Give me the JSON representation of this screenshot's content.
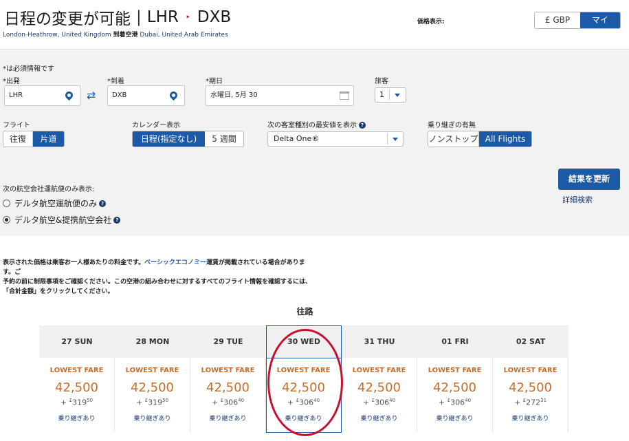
{
  "header": {
    "title_prefix": "日程の変更が可能",
    "origin_code": "LHR",
    "dest_code": "DXB",
    "separator": "|",
    "arrow": "‣",
    "origin_name": "London-Heathrow, United Kingdom",
    "to_label": "到着空港",
    "dest_name": "Dubai, United Arab Emirates",
    "price_display_label": "価格表示:",
    "currency_options": [
      "£ GBP",
      "マイル"
    ],
    "currency_selected": "マイル"
  },
  "form": {
    "required_note": "*は必須情報です",
    "origin_label": "出発",
    "origin_value": "LHR",
    "dest_label": "到着",
    "dest_value": "DXB",
    "date_label": "期日",
    "date_value": "水曜日, 5月 30",
    "passengers_label": "旅客",
    "passengers_value": "1",
    "flight_label": "フライト",
    "flight_options": [
      "往復",
      "片道"
    ],
    "flight_selected": "片道",
    "calendar_label": "カレンダー表示",
    "calendar_options": [
      "日程(指定なし)",
      "5 週間"
    ],
    "calendar_selected": "日程(指定なし)",
    "cabin_label": "次の客室種別の最安値を表示",
    "cabin_value": "Delta One®",
    "connection_label": "乗り継ぎの有無",
    "connection_options": [
      "ノンストップ",
      "All Flights"
    ],
    "connection_selected": "All Flights",
    "update_button": "結果を更新",
    "advanced_search": "詳細検索",
    "carrier_filter_label": "次の航空会社運航便のみ表示:",
    "carrier_options": [
      "デルタ航空運航便のみ",
      "デルタ航空&提携航空会社"
    ],
    "carrier_selected": "デルタ航空&提携航空会社",
    "help_glyph": "?"
  },
  "notice": {
    "line1_a": "表示された価格は乗客お一人様あたりの料金です。",
    "line1_link": "ベーシックエコノミー",
    "line1_b": "運賃が掲載されている場合があります。ご",
    "line2": "予約の前に制限事項をご確認ください。この空港の組み合わせに対するすべてのフライト情報を確認するには、",
    "line3": "「合計金額」をクリックしてください。"
  },
  "fare_calendar": {
    "direction_title": "往路",
    "selected_index": 3,
    "days": [
      {
        "label": "27 SUN",
        "fare_label": "LOWEST FARE",
        "miles": "42,500",
        "gbp_prefix": "+ ",
        "gbp_currency": "£",
        "gbp_main": "319",
        "gbp_cents": "50",
        "stops": "乗り継ぎあり"
      },
      {
        "label": "28 MON",
        "fare_label": "LOWEST FARE",
        "miles": "42,500",
        "gbp_prefix": "+ ",
        "gbp_currency": "£",
        "gbp_main": "319",
        "gbp_cents": "50",
        "stops": "乗り継ぎあり"
      },
      {
        "label": "29 TUE",
        "fare_label": "LOWEST FARE",
        "miles": "42,500",
        "gbp_prefix": "+ ",
        "gbp_currency": "£",
        "gbp_main": "306",
        "gbp_cents": "40",
        "stops": "乗り継ぎあり"
      },
      {
        "label": "30 WED",
        "fare_label": "LOWEST FARE",
        "miles": "42,500",
        "gbp_prefix": "+ ",
        "gbp_currency": "£",
        "gbp_main": "306",
        "gbp_cents": "40",
        "stops": "乗り継ぎあり"
      },
      {
        "label": "31 THU",
        "fare_label": "LOWEST FARE",
        "miles": "42,500",
        "gbp_prefix": "+ ",
        "gbp_currency": "£",
        "gbp_main": "306",
        "gbp_cents": "40",
        "stops": "乗り継ぎあり"
      },
      {
        "label": "01 FRI",
        "fare_label": "LOWEST FARE",
        "miles": "42,500",
        "gbp_prefix": "+ ",
        "gbp_currency": "£",
        "gbp_main": "306",
        "gbp_cents": "40",
        "stops": "乗り継ぎあり"
      },
      {
        "label": "02 SAT",
        "fare_label": "LOWEST FARE",
        "miles": "42,500",
        "gbp_prefix": "+ ",
        "gbp_currency": "£",
        "gbp_main": "272",
        "gbp_cents": "31",
        "stops": "乗り継ぎあり"
      }
    ]
  },
  "colors": {
    "accent": "#1c5aa8",
    "fare": "#c46d2a",
    "highlight_circle": "#c8102e"
  }
}
